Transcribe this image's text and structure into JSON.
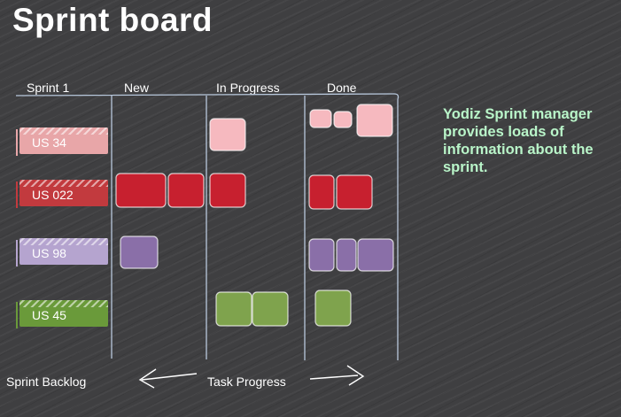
{
  "title": "Sprint board",
  "columns": {
    "backlog": "Sprint 1",
    "new": "New",
    "in_progress": "In Progress",
    "done": "Done"
  },
  "stories": [
    {
      "label": "US 34",
      "color": "#e8a6a8"
    },
    {
      "label": "US 022",
      "color": "#c23a3e"
    },
    {
      "label": "US 98",
      "color": "#b5a4cf"
    },
    {
      "label": "US 45",
      "color": "#6a9a3a"
    }
  ],
  "tasks": {
    "pink": {
      "fill": "#f6b9bf",
      "in_progress": 1,
      "done": 3
    },
    "red": {
      "fill": "#c7202f",
      "new": 2,
      "in_progress": 1,
      "done": 2
    },
    "purple": {
      "fill": "#8a6fa8",
      "new": 1,
      "done": 3
    },
    "green": {
      "fill": "#7fa34d",
      "in_progress": 2,
      "done": 1
    }
  },
  "blurb": "Yodiz Sprint manager provides loads of information about the sprint.",
  "footer": {
    "backlog_label": "Sprint Backlog",
    "progress_label": "Task Progress"
  }
}
